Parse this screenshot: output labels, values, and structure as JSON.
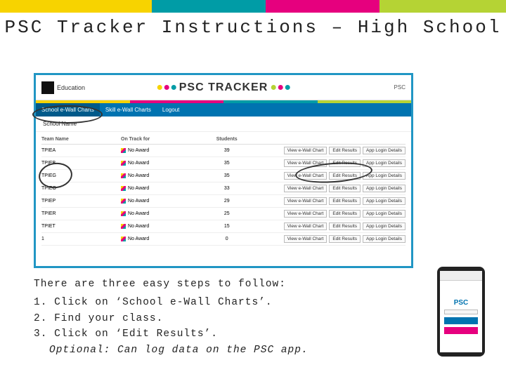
{
  "title": "PSC Tracker Instructions – High School",
  "screenshot": {
    "logo_text": "Education",
    "brand": "PSC TRACKER",
    "psc_badge": "PSC",
    "tabs": {
      "ewall": "School e-Wall Charts",
      "skills": "Skill e-Wall Charts",
      "logout": "Logout"
    },
    "school_name_label": "School Name",
    "columns": {
      "team": "Team Name",
      "track": "On Track for",
      "students": "Students"
    },
    "buttons": {
      "view": "View e-Wall Chart",
      "edit": "Edit Results",
      "app": "App Login Details"
    },
    "award_text": "No Award",
    "rows": [
      {
        "team": "TPIEA",
        "students": "39"
      },
      {
        "team": "TPIEB",
        "students": "35"
      },
      {
        "team": "TPIEG",
        "students": "35"
      },
      {
        "team": "TPIEO",
        "students": "33"
      },
      {
        "team": "TPIEP",
        "students": "29"
      },
      {
        "team": "TPIER",
        "students": "25"
      },
      {
        "team": "TPIET",
        "students": "15"
      },
      {
        "team": "1",
        "students": "0"
      }
    ]
  },
  "instructions": {
    "intro": "There are three easy steps to follow:",
    "step1": "1. Click on ‘School e-Wall Charts’.",
    "step2": "2. Find your class.",
    "step3": "3. Click on ‘Edit Results’.",
    "optional": "Optional: Can log data on the PSC app."
  },
  "phone": {
    "logo": "PSC"
  }
}
